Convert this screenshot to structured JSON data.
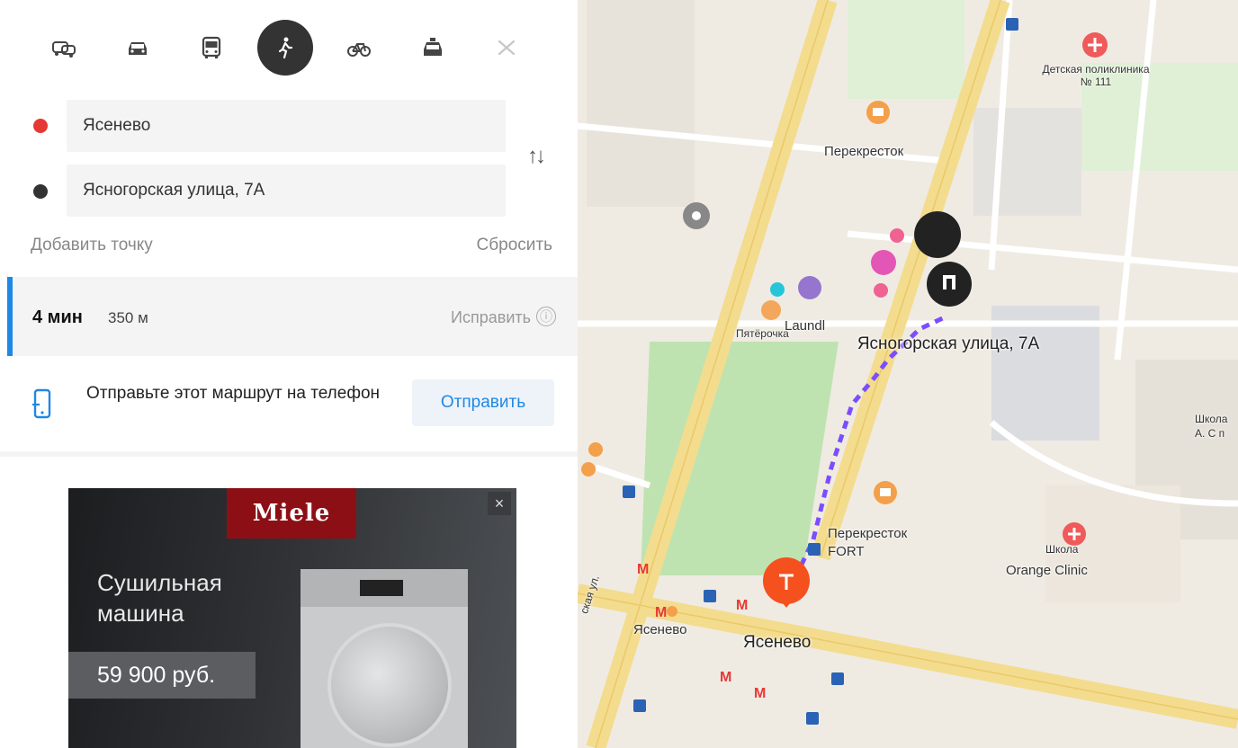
{
  "route_panel": {
    "modes": [
      {
        "name": "multimodal-icon"
      },
      {
        "name": "car-icon"
      },
      {
        "name": "bus-icon"
      },
      {
        "name": "walk-icon",
        "active": true
      },
      {
        "name": "bicycle-icon"
      },
      {
        "name": "taxi-icon"
      },
      {
        "name": "scooter-icon"
      }
    ],
    "from": {
      "value": "Ясенево",
      "color": "#e53935"
    },
    "to": {
      "value": "Ясногорская улица, 7А",
      "color": "#333333"
    },
    "swap_label": "↑↓",
    "add_point": "Добавить точку",
    "reset": "Сбросить"
  },
  "route": {
    "time": "4 мин",
    "distance": "350 м",
    "fix": "Исправить",
    "info_icon": "ⓘ",
    "accent_color": "#1e88e5"
  },
  "send_to_phone": {
    "text": "Отправьте этот маршрут на телефон",
    "button": "Отправить"
  },
  "ad": {
    "brand": "Miele",
    "title": "Сушильная машина",
    "price": "59 900 руб.",
    "close": "×",
    "brand_color": "#8d0f16"
  },
  "map": {
    "labels": {
      "clinic": "Детская поликлиника № 111",
      "perekrestok_top": "Перекресток",
      "pyaterochka": "Пятёрочка",
      "laundry": "Laundl",
      "destination": "Ясногорская улица, 7А",
      "perekrestok_fort": "Перекресток FORT",
      "shkola": "Школа",
      "orange_clinic": "Orange Clinic",
      "yasenevo_metro": "Ясенево",
      "yasenevo_point": "Ясенево",
      "street": "ская ул.",
      "school_right": "Школа А. С п"
    },
    "route_color": "#7b4dff",
    "start_pin_color": "#f4511e"
  }
}
